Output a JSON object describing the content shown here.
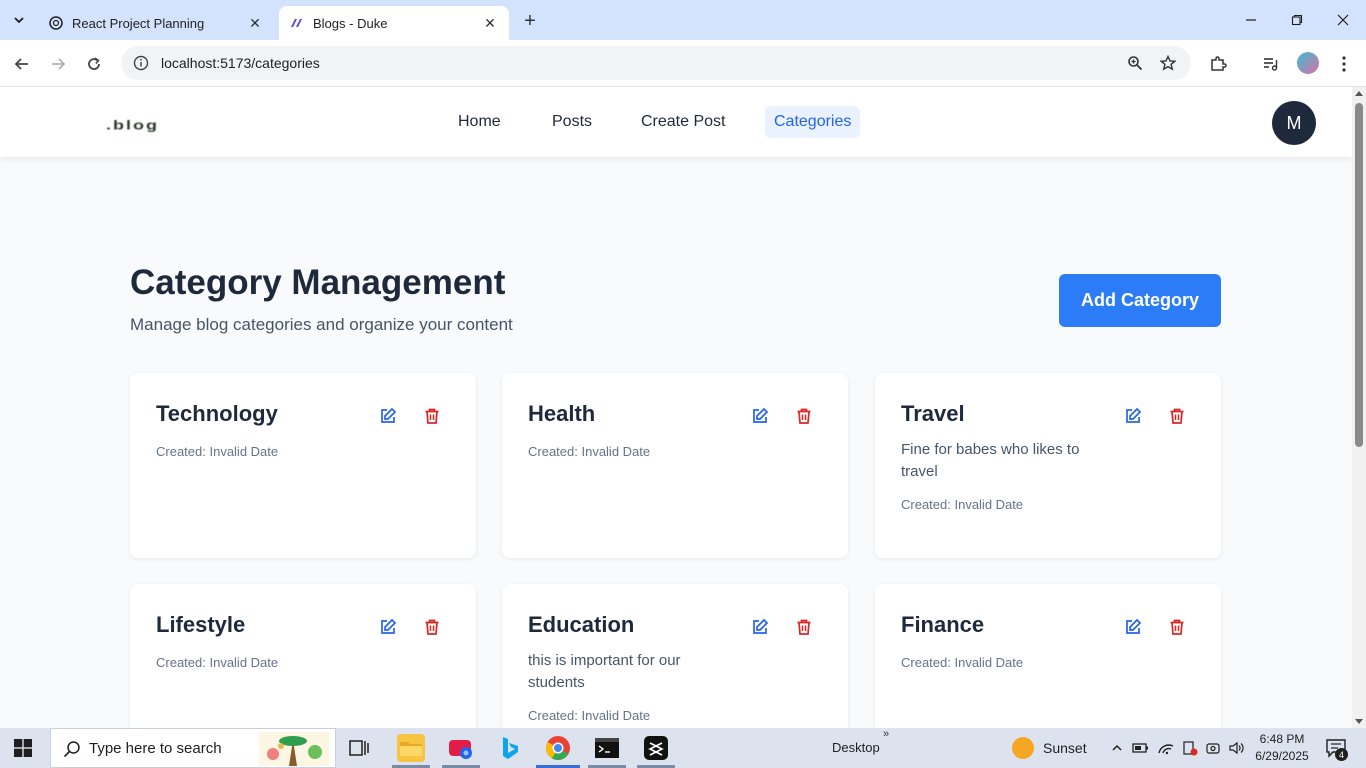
{
  "browser": {
    "tabs": [
      {
        "title": "React Project Planning",
        "active": false
      },
      {
        "title": "Blogs - Duke",
        "active": true
      }
    ],
    "url": "localhost:5173/categories"
  },
  "site": {
    "logo_text": ".blog",
    "nav": [
      {
        "label": "Home",
        "active": false
      },
      {
        "label": "Posts",
        "active": false
      },
      {
        "label": "Create Post",
        "active": false
      },
      {
        "label": "Categories",
        "active": true
      }
    ],
    "avatar_initial": "M"
  },
  "page": {
    "title": "Category Management",
    "subtitle": "Manage blog categories and organize your content",
    "add_button": "Add Category"
  },
  "categories": [
    {
      "name": "Technology",
      "description": "",
      "created": "Created: Invalid Date"
    },
    {
      "name": "Health",
      "description": "",
      "created": "Created: Invalid Date"
    },
    {
      "name": "Travel",
      "description": "Fine for babes who likes to travel",
      "created": "Created: Invalid Date"
    },
    {
      "name": "Lifestyle",
      "description": "",
      "created": "Created: Invalid Date"
    },
    {
      "name": "Education",
      "description": "this is important for our students",
      "created": "Created: Invalid Date"
    },
    {
      "name": "Finance",
      "description": "",
      "created": "Created: Invalid Date"
    }
  ],
  "colors": {
    "accent": "#2b7cf6",
    "nav_active_bg": "#eaf2ff",
    "edit_icon": "#2563eb",
    "delete_icon": "#dc2626",
    "heading": "#1e293b"
  },
  "taskbar": {
    "search_placeholder": "Type here to search",
    "desktop_label": "Desktop",
    "weather": "Sunset",
    "time": "6:48 PM",
    "date": "6/29/2025",
    "notification_count": "4"
  }
}
